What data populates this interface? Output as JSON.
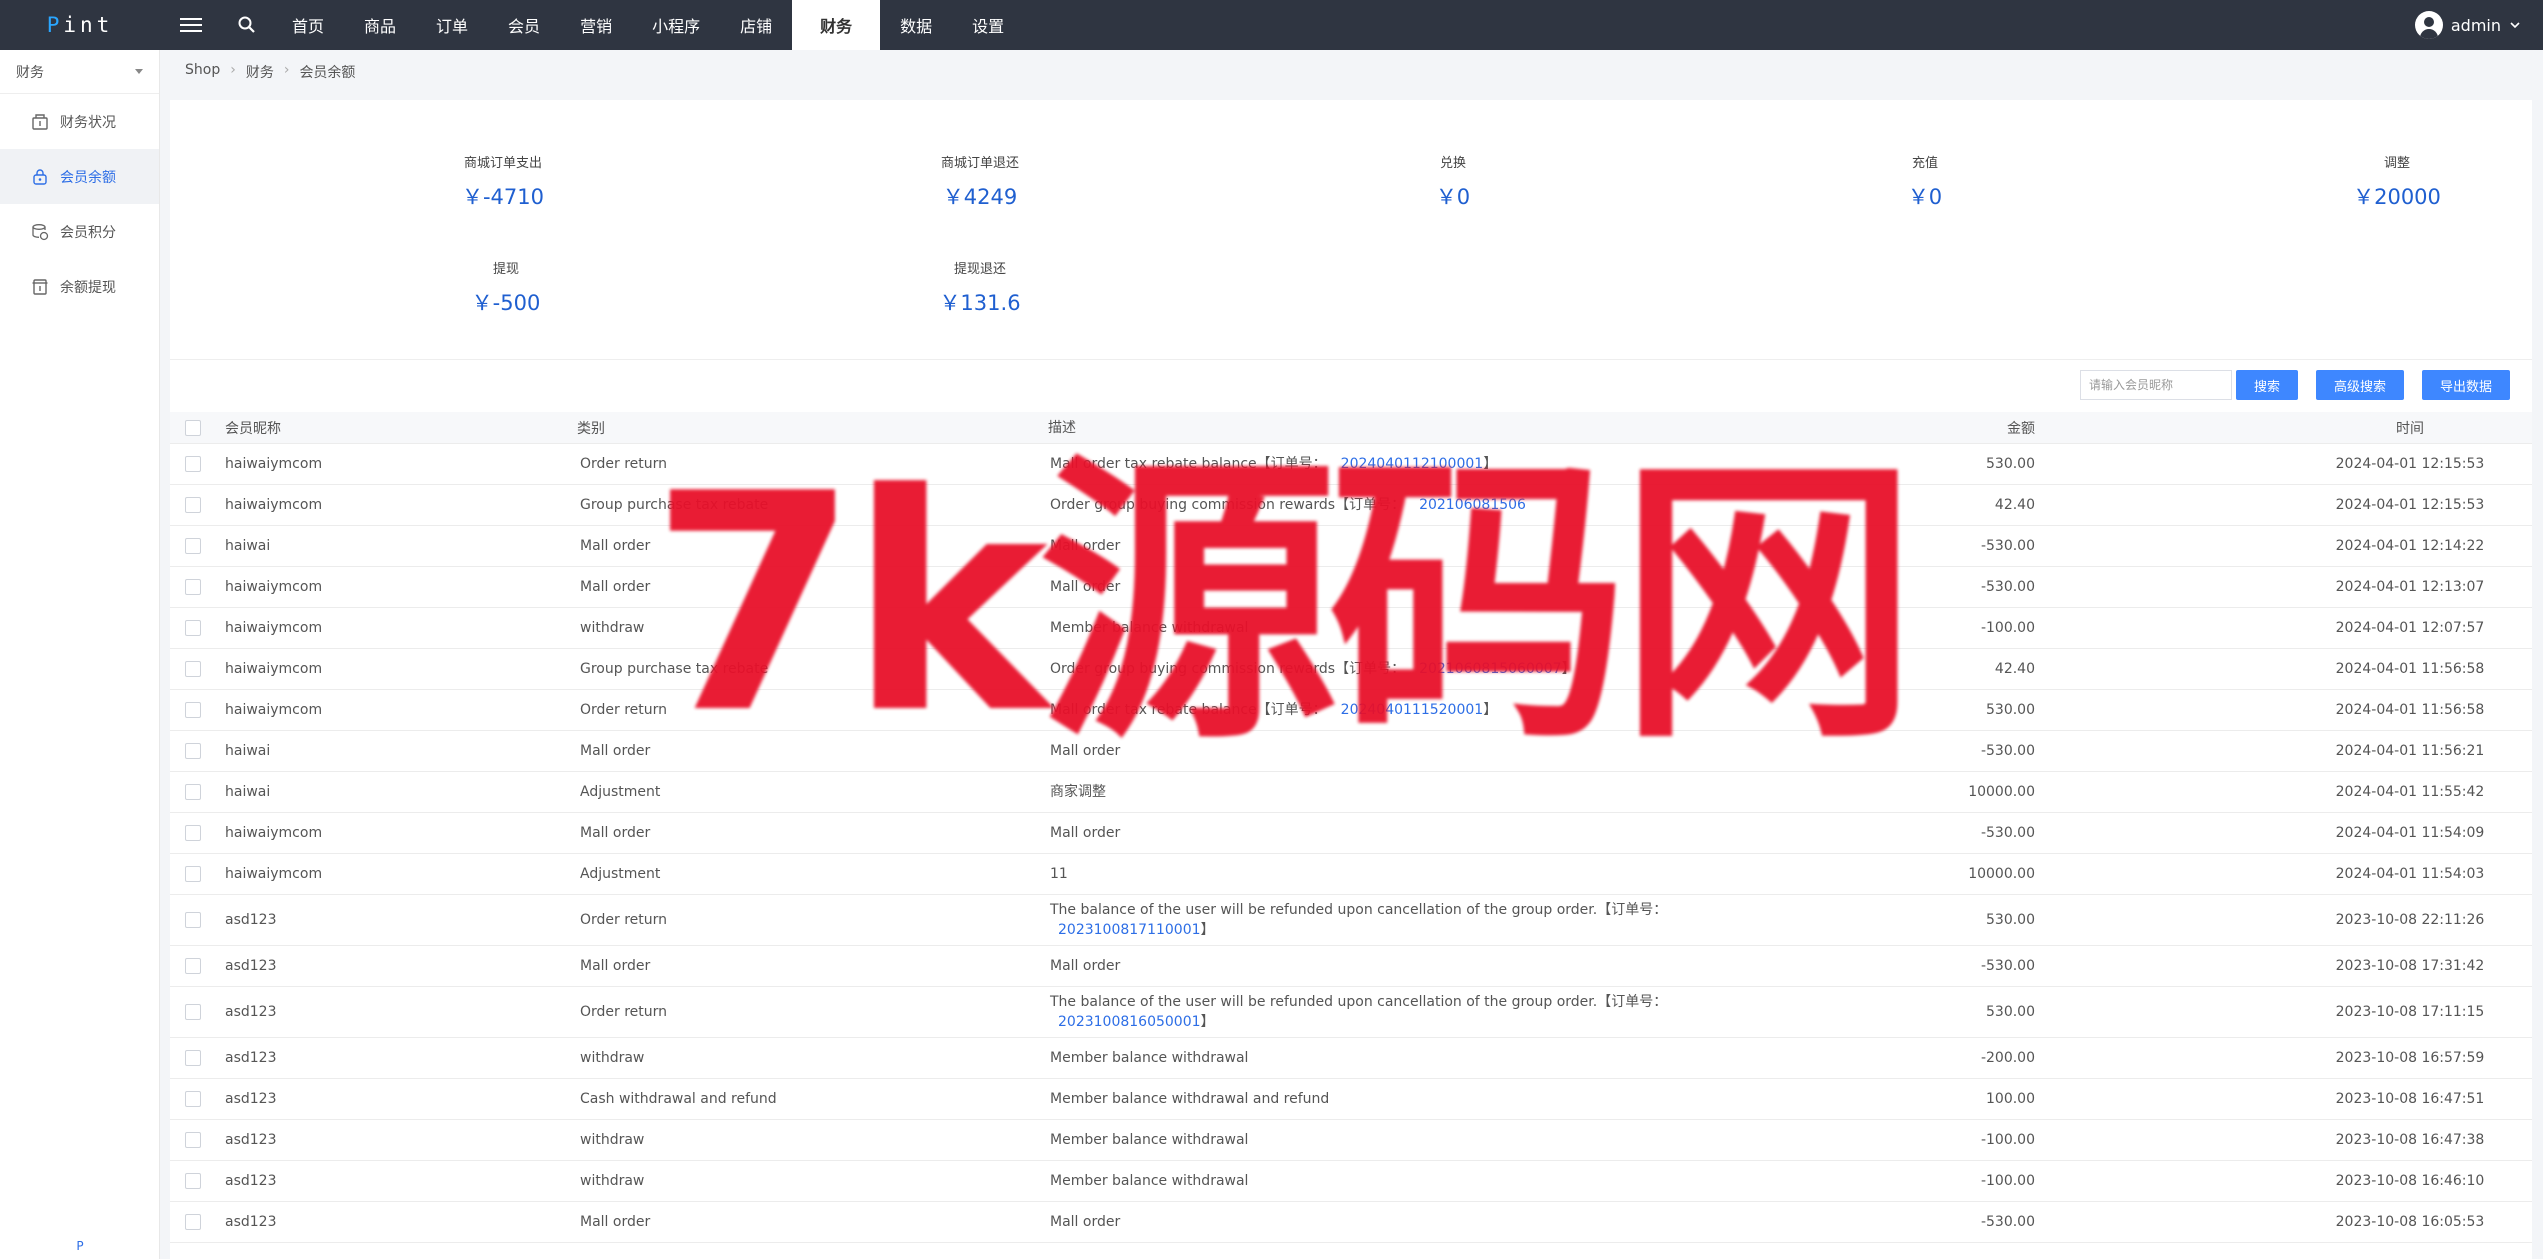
{
  "brand": {
    "p": "P",
    "rest": "int"
  },
  "nav": [
    "首页",
    "商品",
    "订单",
    "会员",
    "营销",
    "小程序",
    "店铺",
    "财务",
    "数据",
    "设置"
  ],
  "user": {
    "name": "admin"
  },
  "sidebar": {
    "title": "财务",
    "items": [
      "财务状况",
      "会员余额",
      "会员积分",
      "余额提现"
    ],
    "footer": "P"
  },
  "breadcrumb": [
    "Shop",
    "财务",
    "会员余额"
  ],
  "stats": [
    {
      "label": "商城订单支出",
      "value": "￥-4710"
    },
    {
      "label": "商城订单退还",
      "value": "￥4249"
    },
    {
      "label": "兑换",
      "value": "￥0"
    },
    {
      "label": "充值",
      "value": "￥0"
    },
    {
      "label": "调整",
      "value": "￥20000"
    },
    {
      "label": "提现",
      "value": "￥-500"
    },
    {
      "label": "提现退还",
      "value": "￥131.6"
    }
  ],
  "toolbar": {
    "placeholder": "请输入会员昵称",
    "search": "搜索",
    "advanced": "高级搜索",
    "export": "导出数据"
  },
  "table": {
    "headers": [
      "会员昵称",
      "类别",
      "描述",
      "金额",
      "时间"
    ],
    "rows": [
      {
        "name": "haiwaiymcom",
        "type": "Order return",
        "desc": "Mall order tax rebate balance【订单号：",
        "link": "2024040112100001",
        "tail": "】",
        "amount": "530.00",
        "time": "2024-04-01 12:15:53"
      },
      {
        "name": "haiwaiymcom",
        "type": "Group purchase tax rebate",
        "desc": "Order group buying commission rewards【订单号：",
        "link": "202106081506",
        "tail": "",
        "amount": "42.40",
        "time": "2024-04-01 12:15:53"
      },
      {
        "name": "haiwai",
        "type": "Mall order",
        "desc": "Mall order",
        "link": "",
        "tail": "",
        "amount": "-530.00",
        "time": "2024-04-01 12:14:22"
      },
      {
        "name": "haiwaiymcom",
        "type": "Mall order",
        "desc": "Mall order",
        "link": "",
        "tail": "",
        "amount": "-530.00",
        "time": "2024-04-01 12:13:07"
      },
      {
        "name": "haiwaiymcom",
        "type": "withdraw",
        "desc": "Member balance withdrawal",
        "link": "",
        "tail": "",
        "amount": "-100.00",
        "time": "2024-04-01 12:07:57"
      },
      {
        "name": "haiwaiymcom",
        "type": "Group purchase tax rebate",
        "desc": "Order group buying commission rewards【订单号：",
        "link": "2021060815060007",
        "tail": "】",
        "amount": "42.40",
        "time": "2024-04-01 11:56:58"
      },
      {
        "name": "haiwaiymcom",
        "type": "Order return",
        "desc": "Mall order tax rebate balance【订单号：",
        "link": "2024040111520001",
        "tail": "】",
        "amount": "530.00",
        "time": "2024-04-01 11:56:58"
      },
      {
        "name": "haiwai",
        "type": "Mall order",
        "desc": "Mall order",
        "link": "",
        "tail": "",
        "amount": "-530.00",
        "time": "2024-04-01 11:56:21"
      },
      {
        "name": "haiwai",
        "type": "Adjustment",
        "desc": "商家调整",
        "link": "",
        "tail": "",
        "amount": "10000.00",
        "time": "2024-04-01 11:55:42"
      },
      {
        "name": "haiwaiymcom",
        "type": "Mall order",
        "desc": "Mall order",
        "link": "",
        "tail": "",
        "amount": "-530.00",
        "time": "2024-04-01 11:54:09"
      },
      {
        "name": "haiwaiymcom",
        "type": "Adjustment",
        "desc": "11",
        "link": "",
        "tail": "",
        "amount": "10000.00",
        "time": "2024-04-01 11:54:03"
      },
      {
        "name": "asd123",
        "type": "Order return",
        "desc": "The balance of the user will be refunded upon cancellation of the group order.【订单号：",
        "link": "2023100817110001",
        "tail": "】",
        "amount": "530.00",
        "time": "2023-10-08 22:11:26",
        "tall": true
      },
      {
        "name": "asd123",
        "type": "Mall order",
        "desc": "Mall order",
        "link": "",
        "tail": "",
        "amount": "-530.00",
        "time": "2023-10-08 17:31:42"
      },
      {
        "name": "asd123",
        "type": "Order return",
        "desc": "The balance of the user will be refunded upon cancellation of the group order.【订单号：",
        "link": "2023100816050001",
        "tail": "】",
        "amount": "530.00",
        "time": "2023-10-08 17:11:15",
        "tall": true
      },
      {
        "name": "asd123",
        "type": "withdraw",
        "desc": "Member balance withdrawal",
        "link": "",
        "tail": "",
        "amount": "-200.00",
        "time": "2023-10-08 16:57:59"
      },
      {
        "name": "asd123",
        "type": "Cash withdrawal and refund",
        "desc": "Member balance withdrawal and refund",
        "link": "",
        "tail": "",
        "amount": "100.00",
        "time": "2023-10-08 16:47:51"
      },
      {
        "name": "asd123",
        "type": "withdraw",
        "desc": "Member balance withdrawal",
        "link": "",
        "tail": "",
        "amount": "-100.00",
        "time": "2023-10-08 16:47:38"
      },
      {
        "name": "asd123",
        "type": "withdraw",
        "desc": "Member balance withdrawal",
        "link": "",
        "tail": "",
        "amount": "-100.00",
        "time": "2023-10-08 16:46:10"
      },
      {
        "name": "asd123",
        "type": "Mall order",
        "desc": "Mall order",
        "link": "",
        "tail": "",
        "amount": "-530.00",
        "time": "2023-10-08 16:05:53"
      }
    ]
  },
  "watermark": "7k源码网"
}
